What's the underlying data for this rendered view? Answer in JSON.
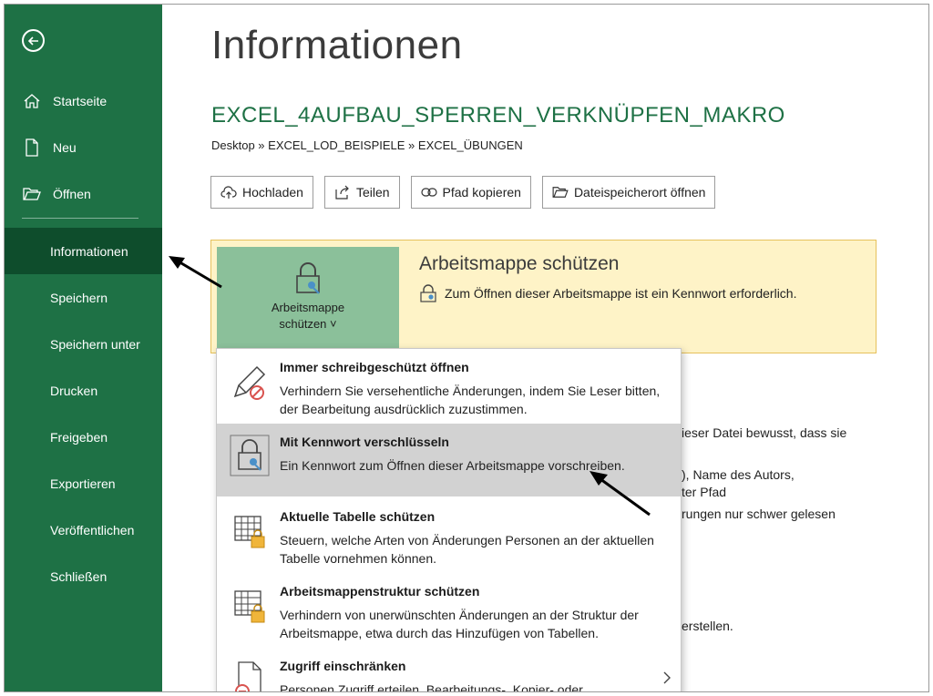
{
  "sidebar": {
    "back_label": "Zurück",
    "top_items": [
      {
        "label": "Startseite",
        "icon": "home-icon"
      },
      {
        "label": "Neu",
        "icon": "new-document-icon"
      },
      {
        "label": "Öffnen",
        "icon": "folder-open-icon"
      }
    ],
    "items": [
      {
        "label": "Informationen",
        "active": true
      },
      {
        "label": "Speichern"
      },
      {
        "label": "Speichern unter"
      },
      {
        "label": "Drucken"
      },
      {
        "label": "Freigeben"
      },
      {
        "label": "Exportieren"
      },
      {
        "label": "Veröffentlichen"
      },
      {
        "label": "Schließen"
      }
    ],
    "color": "#1e7145",
    "active_color": "#0e4d2c"
  },
  "main": {
    "title": "Informationen",
    "file_name": "EXCEL_4AUFBAU_SPERREN_VERKNÜPFEN_MAKRO",
    "breadcrumb": "Desktop » EXCEL_LOD_BEISPIELE » EXCEL_ÜBUNGEN",
    "actions": [
      {
        "label": "Hochladen",
        "icon": "cloud-upload-icon"
      },
      {
        "label": "Teilen",
        "icon": "share-icon"
      },
      {
        "label": "Pfad kopieren",
        "icon": "link-icon"
      },
      {
        "label": "Dateispeicherort öffnen",
        "icon": "folder-open-icon"
      }
    ],
    "protect": {
      "button_line1": "Arbeitsmappe",
      "button_line2": "schützen ˅",
      "title": "Arbeitsmappe schützen",
      "description": "Zum Öffnen dieser Arbeitsmappe ist ein Kennwort erforderlich."
    },
    "background_text": {
      "line1": "ieser Datei bewusst, dass sie",
      "line2": "), Name des Autors,",
      "line3": "ter Pfad",
      "line4": "rungen nur schwer gelesen",
      "line5": "erstellen."
    }
  },
  "menu": {
    "items": [
      {
        "title": "Immer schreibgeschützt öffnen",
        "description": "Verhindern Sie versehentliche Änderungen, indem Sie Leser bitten, der Bearbeitung ausdrücklich zuzustimmen.",
        "icon": "pencil-no-icon"
      },
      {
        "title": "Mit Kennwort verschlüsseln",
        "description": "Ein Kennwort zum Öffnen dieser Arbeitsmappe vorschreiben.",
        "icon": "lock-key-icon",
        "highlighted": true
      },
      {
        "title": "Aktuelle Tabelle schützen",
        "description": "Steuern, welche Arten von Änderungen Personen an der aktuellen Tabelle vornehmen können.",
        "icon": "sheet-lock-icon"
      },
      {
        "title": "Arbeitsmappenstruktur schützen",
        "description": "Verhindern von unerwünschten Änderungen an der Struktur der Arbeitsmappe, etwa durch das Hinzufügen von Tabellen.",
        "icon": "workbook-lock-icon"
      },
      {
        "title": "Zugriff einschränken",
        "description": "Personen Zugriff erteilen, Bearbeitungs-, Kopier- oder Druckberechtigung jedoch entfernen.",
        "icon": "document-restrict-icon"
      }
    ],
    "highlight_color": "#d2d2d2"
  }
}
